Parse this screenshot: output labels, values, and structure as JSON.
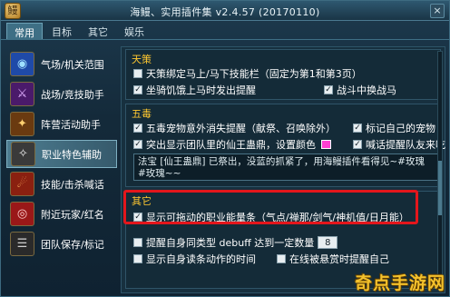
{
  "window": {
    "title": "海鳗、实用插件集 v2.4.57 (20170110)",
    "close_label": "×",
    "logo_glyph": "鳗"
  },
  "tabs": [
    {
      "label": "常用",
      "active": true
    },
    {
      "label": "目标",
      "active": false
    },
    {
      "label": "其它",
      "active": false
    },
    {
      "label": "娱乐",
      "active": false
    }
  ],
  "sidebar": {
    "items": [
      {
        "label": "气场/机关范围",
        "icon": "aura-icon",
        "glyph": "◉",
        "active": false
      },
      {
        "label": "战场/竞技助手",
        "icon": "battlefield-icon",
        "glyph": "⚔",
        "active": false
      },
      {
        "label": "阵营活动助手",
        "icon": "faction-icon",
        "glyph": "✦",
        "active": false
      },
      {
        "label": "职业特色辅助",
        "icon": "profession-icon",
        "glyph": "✧",
        "active": true
      },
      {
        "label": "技能/击杀喊话",
        "icon": "skill-icon",
        "glyph": "☄",
        "active": false
      },
      {
        "label": "附近玩家/红名",
        "icon": "nearby-player-icon",
        "glyph": "◎",
        "active": false
      },
      {
        "label": "团队保存/标记",
        "icon": "team-icon",
        "glyph": "☰",
        "active": false
      }
    ]
  },
  "sections": {
    "tiance": {
      "title": "天策",
      "options": [
        {
          "label": "天策绑定马上/马下技能栏（固定为第1和第3页）",
          "checked": false
        },
        {
          "label": "坐骑饥饿上马时发出提醒",
          "checked": true
        },
        {
          "label": "战斗中换战马",
          "checked": true
        }
      ]
    },
    "wudu": {
      "title": "五毒",
      "options": [
        {
          "label": "五毒宠物意外消失提醒（献祭、召唤除外）",
          "checked": true
        },
        {
          "label": "标记自己的宠物",
          "checked": true
        },
        {
          "label": "突出显示团队里的仙王蛊鼎，设置颜色",
          "checked": true
        },
        {
          "label": "喊话提醒队友来吃",
          "checked": true
        }
      ],
      "message": "法宝 [仙王蛊鼎] 已祭出，没蓝的抓紧了，用海鳗插件看得见~#玫瑰 #玫瑰~~"
    },
    "other": {
      "title": "其它",
      "options": [
        {
          "label": "显示可拖动的职业能量条（气点/禅那/剑气/神机值/日月能）",
          "checked": true
        },
        {
          "label": "提醒自身同类型 debuff 达到一定数量",
          "checked": false,
          "value": "8"
        },
        {
          "label": "显示自身读条动作的时间",
          "checked": false
        },
        {
          "label": "在线被悬赏时提醒自己",
          "checked": false
        }
      ]
    }
  },
  "watermark": "奇点手游网",
  "colors": {
    "section_title": "#ffc830",
    "highlight": "#e3161c",
    "swatch": "#ff3fd2"
  }
}
